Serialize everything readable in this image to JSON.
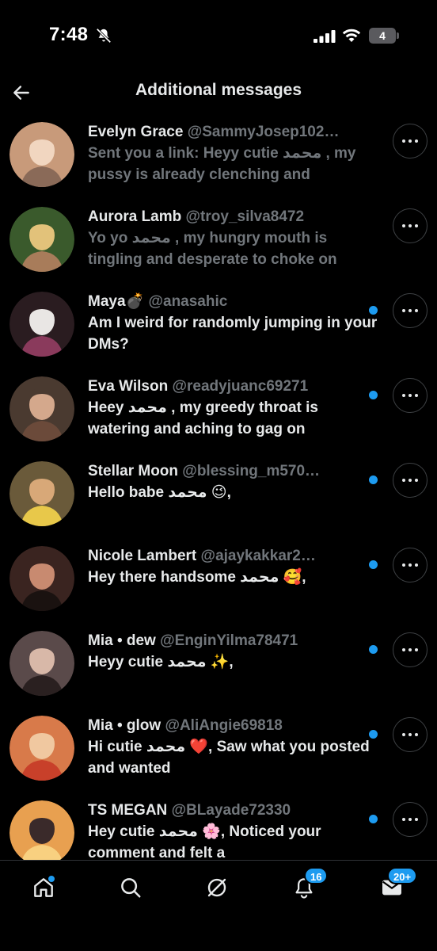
{
  "status_bar": {
    "time": "7:48",
    "battery": "4"
  },
  "header": {
    "title": "Additional messages",
    "back_icon": "arrow-left-icon"
  },
  "messages": [
    {
      "name": "Evelyn Grace",
      "handle": "@SammyJosep102…",
      "preview": "Sent you a link: Heyy cutie محمد  , my pussy is already clenching and",
      "unread": false,
      "avatar_colors": [
        "#c89a7a",
        "#f1d6c0",
        "#8a6a58"
      ]
    },
    {
      "name": "Aurora Lamb",
      "handle": "@troy_silva8472",
      "preview": "Yo yo محمد  , my hungry mouth is tingling and desperate to choke on",
      "unread": false,
      "avatar_colors": [
        "#3a5a2c",
        "#e2c27a",
        "#a87c5a"
      ]
    },
    {
      "name": "Maya💣",
      "handle": "@anasahic",
      "preview": "Am I weird for randomly jumping in your DMs?",
      "unread": true,
      "avatar_colors": [
        "#2a1c20",
        "#e9e6e4",
        "#8a3a5c"
      ]
    },
    {
      "name": "Eva Wilson",
      "handle": "@readyjuanc69271",
      "preview": "Heey محمد  , my greedy throat is watering and aching to gag on",
      "unread": true,
      "avatar_colors": [
        "#4a3a30",
        "#d4a88c",
        "#6b4a3a"
      ]
    },
    {
      "name": "Stellar Moon",
      "handle": "@blessing_m570…",
      "preview": "Hello babe محمد 😉,",
      "unread": true,
      "avatar_colors": [
        "#6a5a3a",
        "#d8a878",
        "#e8c84a"
      ]
    },
    {
      "name": "Nicole Lambert",
      "handle": "@ajaykakkar2…",
      "preview": "Hey there handsome محمد 🥰,",
      "unread": true,
      "avatar_colors": [
        "#3a2420",
        "#c88a70",
        "#1a1210"
      ]
    },
    {
      "name": "Mia • dew",
      "handle": "@EnginYilma78471",
      "preview": "Heyy cutie محمد ✨,",
      "unread": true,
      "avatar_colors": [
        "#5a4a4a",
        "#d8b8a8",
        "#2a2020"
      ]
    },
    {
      "name": "Mia • glow",
      "handle": "@AliAngie69818",
      "preview": "Hi cutie محمد ❤️, Saw what you posted and wanted",
      "unread": true,
      "avatar_colors": [
        "#d87a4a",
        "#f0c8a0",
        "#c8402a"
      ]
    },
    {
      "name": "TS MEGAN",
      "handle": "@BLayade72330",
      "preview": "Hey cutie محمد 🌸, Noticed your comment and felt a",
      "unread": true,
      "avatar_colors": [
        "#e8a050",
        "#3a2a2a",
        "#f8d080"
      ]
    }
  ],
  "bottom_nav": {
    "items": [
      {
        "icon": "home-icon",
        "badge": ""
      },
      {
        "icon": "search-icon",
        "badge": ""
      },
      {
        "icon": "grok-icon",
        "badge": ""
      },
      {
        "icon": "notifications-bell-icon",
        "badge": "16"
      },
      {
        "icon": "messages-envelope-icon",
        "badge": "20+"
      }
    ]
  },
  "colors": {
    "background": "#000000",
    "accent": "#1d9bf0",
    "secondary_text": "#71767b",
    "primary_text": "#e7e9ea"
  }
}
